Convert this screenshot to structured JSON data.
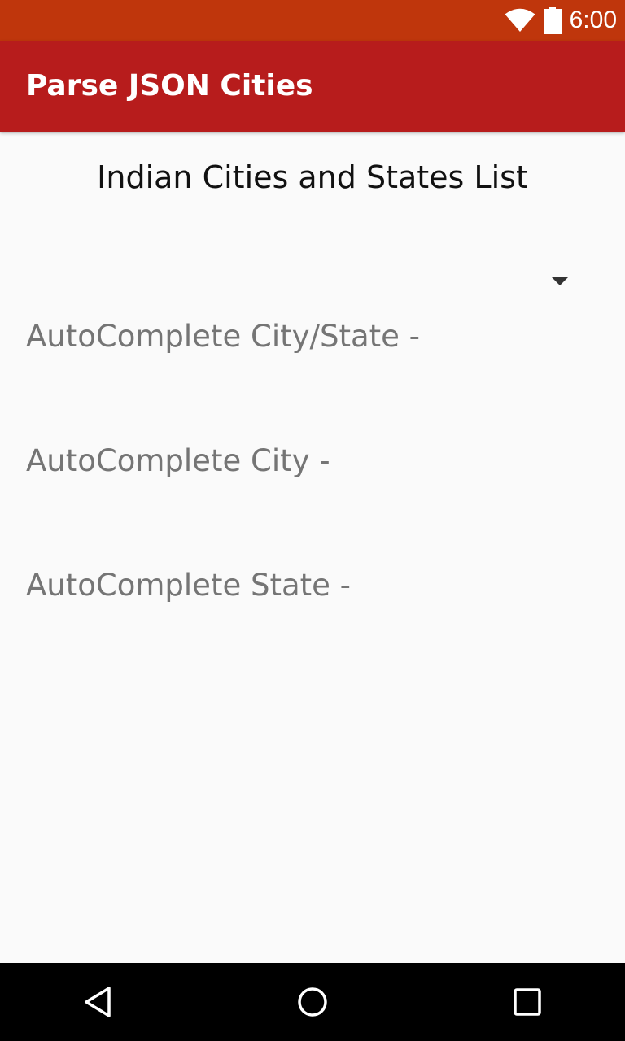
{
  "status_bar": {
    "time": "6:00",
    "background": "#bf360c",
    "icons": [
      "wifi-icon",
      "battery-icon"
    ]
  },
  "app_bar": {
    "title": "Parse JSON Cities",
    "background": "#b71c1c"
  },
  "main": {
    "heading": "Indian Cities and States List",
    "spinner": {
      "selected": "",
      "icon": "dropdown-arrow-icon"
    },
    "fields": [
      {
        "placeholder": "AutoComplete City/State -",
        "value": ""
      },
      {
        "placeholder": "AutoComplete City -",
        "value": ""
      },
      {
        "placeholder": "AutoComplete State -",
        "value": ""
      }
    ]
  },
  "nav_bar": {
    "icons": [
      "back-icon",
      "home-icon",
      "recents-icon"
    ]
  }
}
